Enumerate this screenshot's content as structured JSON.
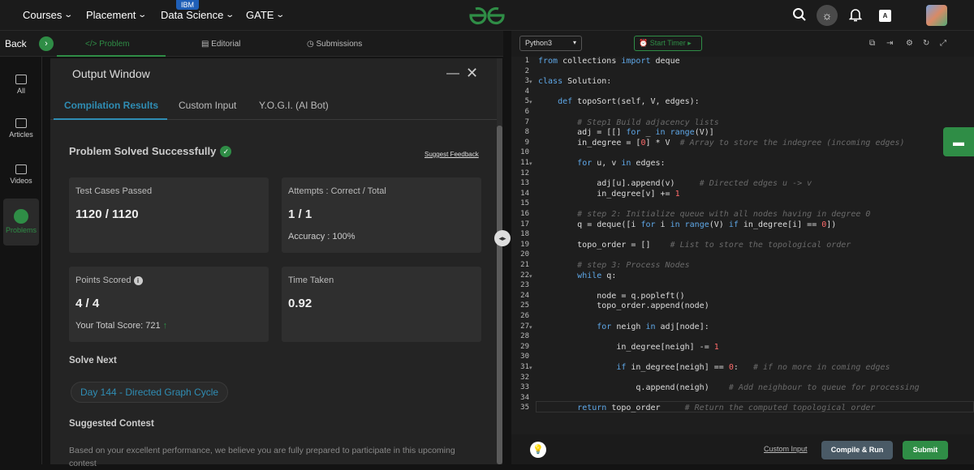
{
  "topnav": {
    "items": [
      "Courses",
      "Placement",
      "Data Science",
      "GATE"
    ],
    "badge": "IBM"
  },
  "subbar": {
    "back": "Back",
    "tabs": [
      "</> Problem",
      "Editorial",
      "Submissions"
    ]
  },
  "leftnav": [
    "All",
    "Articles",
    "Videos",
    "Problems"
  ],
  "output": {
    "title": "Output Window",
    "tabs": [
      "Compilation Results",
      "Custom Input",
      "Y.O.G.I. (AI Bot)"
    ],
    "solved": "Problem Solved Successfully",
    "feedback": "Suggest Feedback",
    "cards": {
      "tests_label": "Test Cases Passed",
      "tests_value": "1120 / 1120",
      "attempts_label": "Attempts : Correct / Total",
      "attempts_value": "1 / 1",
      "accuracy": "Accuracy : 100%",
      "points_label": "Points Scored",
      "points_value": "4 / 4",
      "total_score": "Your Total Score: 721",
      "time_label": "Time Taken",
      "time_value": "0.92"
    },
    "solve_next": "Solve Next",
    "next_problem": "Day 144 - Directed Graph Cycle",
    "suggested_contest": "Suggested Contest",
    "contest_text": "Based on your excellent performance, we believe you are fully prepared to participate in this upcoming contest"
  },
  "editor": {
    "language": "Python3",
    "timer": "Start Timer",
    "code_lines": [
      "from collections import deque",
      "",
      "class Solution:",
      "",
      "    def topoSort(self, V, edges):",
      "",
      "        # Step1 Build adjacency lists",
      "        adj = [[] for _ in range(V)]",
      "        in_degree = [0] * V  # Array to store the indegree (incoming edges)",
      "",
      "        for u, v in edges:",
      "",
      "            adj[u].append(v)     # Directed edges u -> v",
      "            in_degree[v] += 1",
      "",
      "        # step 2: Initialize queue with all nodes having in degree 0",
      "        q = deque([i for i in range(V) if in_degree[i] == 0])",
      "",
      "        topo_order = []    # List to store the topological order",
      "",
      "        # step 3: Process Nodes",
      "        while q:",
      "",
      "            node = q.popleft()",
      "            topo_order.append(node)",
      "",
      "            for neigh in adj[node]:",
      "",
      "                in_degree[neigh] -= 1",
      "",
      "                if in_degree[neigh] == 0:   # if no more in coming edges",
      "",
      "                    q.append(neigh)    # Add neighbour to queue for processing",
      "",
      "        return topo_order     # Return the computed topological order"
    ],
    "custom_input": "Custom Input",
    "compile_run": "Compile & Run",
    "submit": "Submit"
  }
}
